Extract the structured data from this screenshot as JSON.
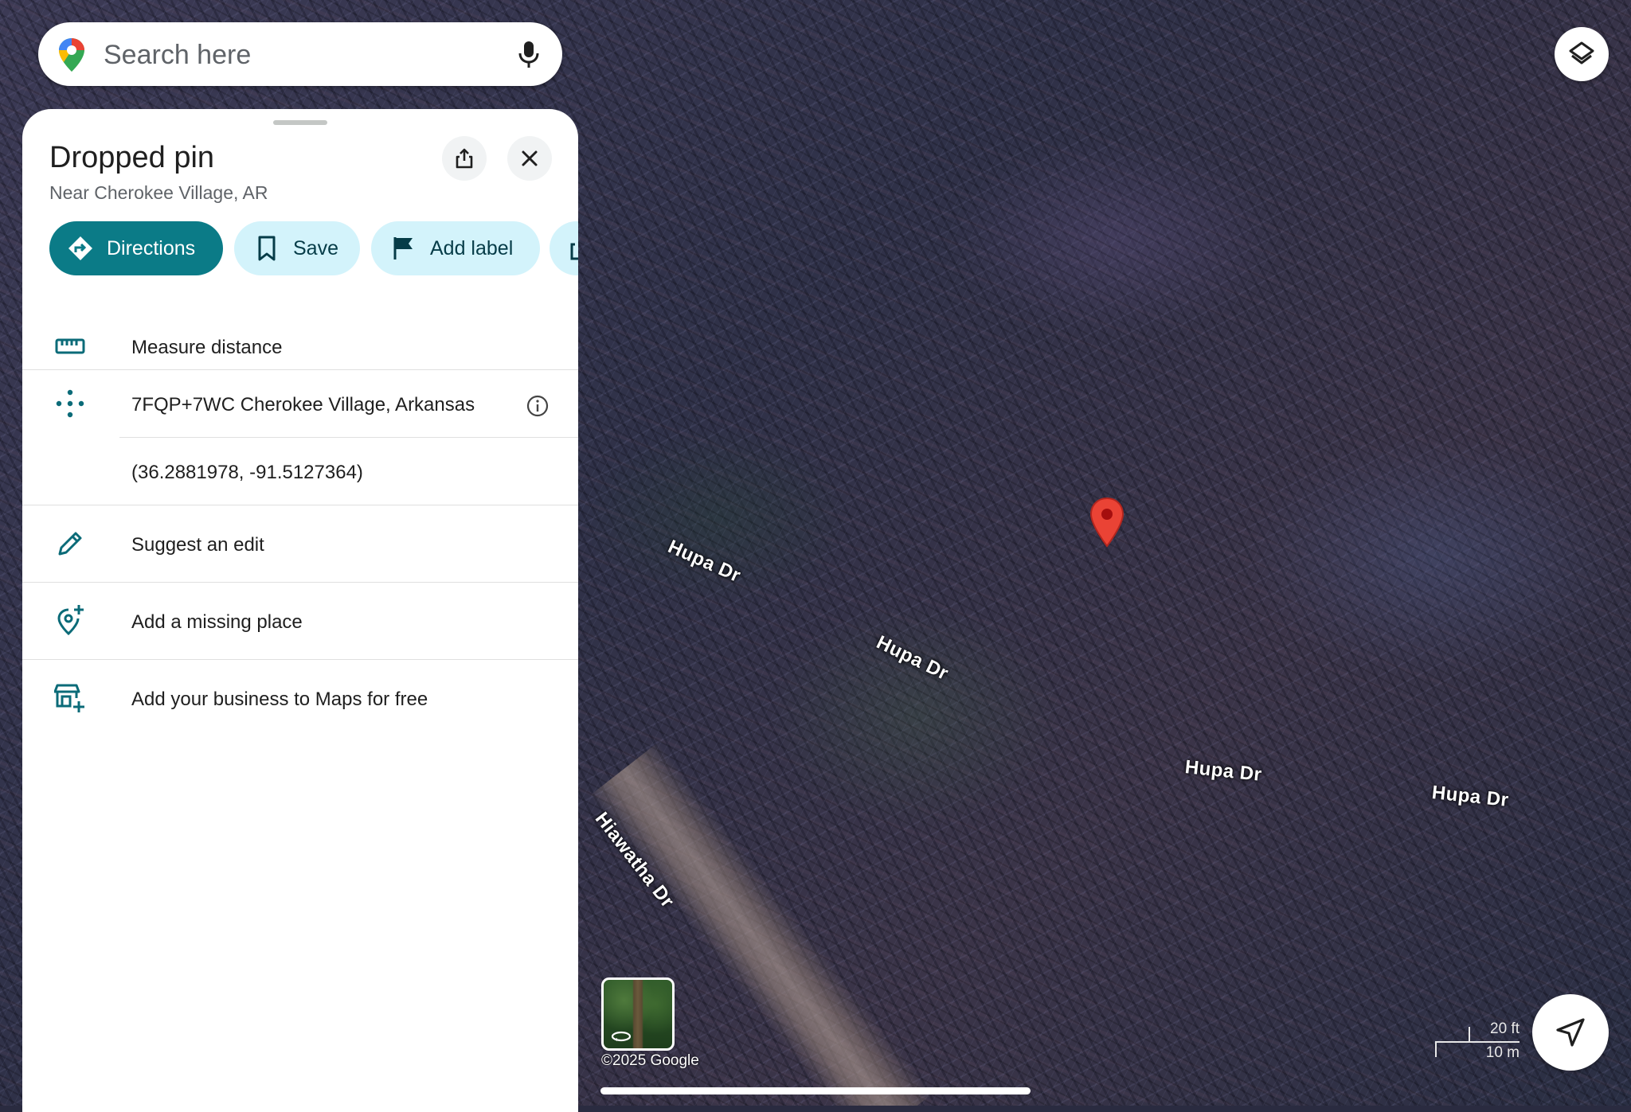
{
  "search": {
    "placeholder": "Search here",
    "logo_icon": "google-maps-pin-icon",
    "mic_icon": "microphone-icon"
  },
  "map": {
    "layers_icon": "layers-icon",
    "road_labels": [
      "Hupa Dr",
      "Hupa Dr",
      "Hupa Dr",
      "Hupa Dr",
      "Hiawatha Dr"
    ],
    "pin_color": "#ea4335",
    "copyright": "©2025 Google",
    "scale": {
      "ft": "20 ft",
      "m": "10 m"
    },
    "locate_icon": "navigation-arrow-icon",
    "street_view_icon": "street-view-360-icon"
  },
  "panel": {
    "title": "Dropped pin",
    "subtitle": "Near Cherokee Village, AR",
    "share_icon": "share-icon",
    "close_icon": "close-icon",
    "actions": [
      {
        "label": "Directions",
        "icon": "directions-icon"
      },
      {
        "label": "Save",
        "icon": "bookmark-icon"
      },
      {
        "label": "Add label",
        "icon": "flag-icon"
      }
    ],
    "rows": {
      "measure": "Measure distance",
      "plus_code": "7FQP+7WC Cherokee Village, Arkansas",
      "coordinates": "(36.2881978, -91.5127364)",
      "suggest_edit": "Suggest an edit",
      "add_place": "Add a missing place",
      "add_business": "Add your business to Maps for free"
    }
  },
  "colors": {
    "primary_chip": "#0b7b87",
    "secondary_chip": "#d3f3fb",
    "icon_teal": "#0b6b78"
  }
}
